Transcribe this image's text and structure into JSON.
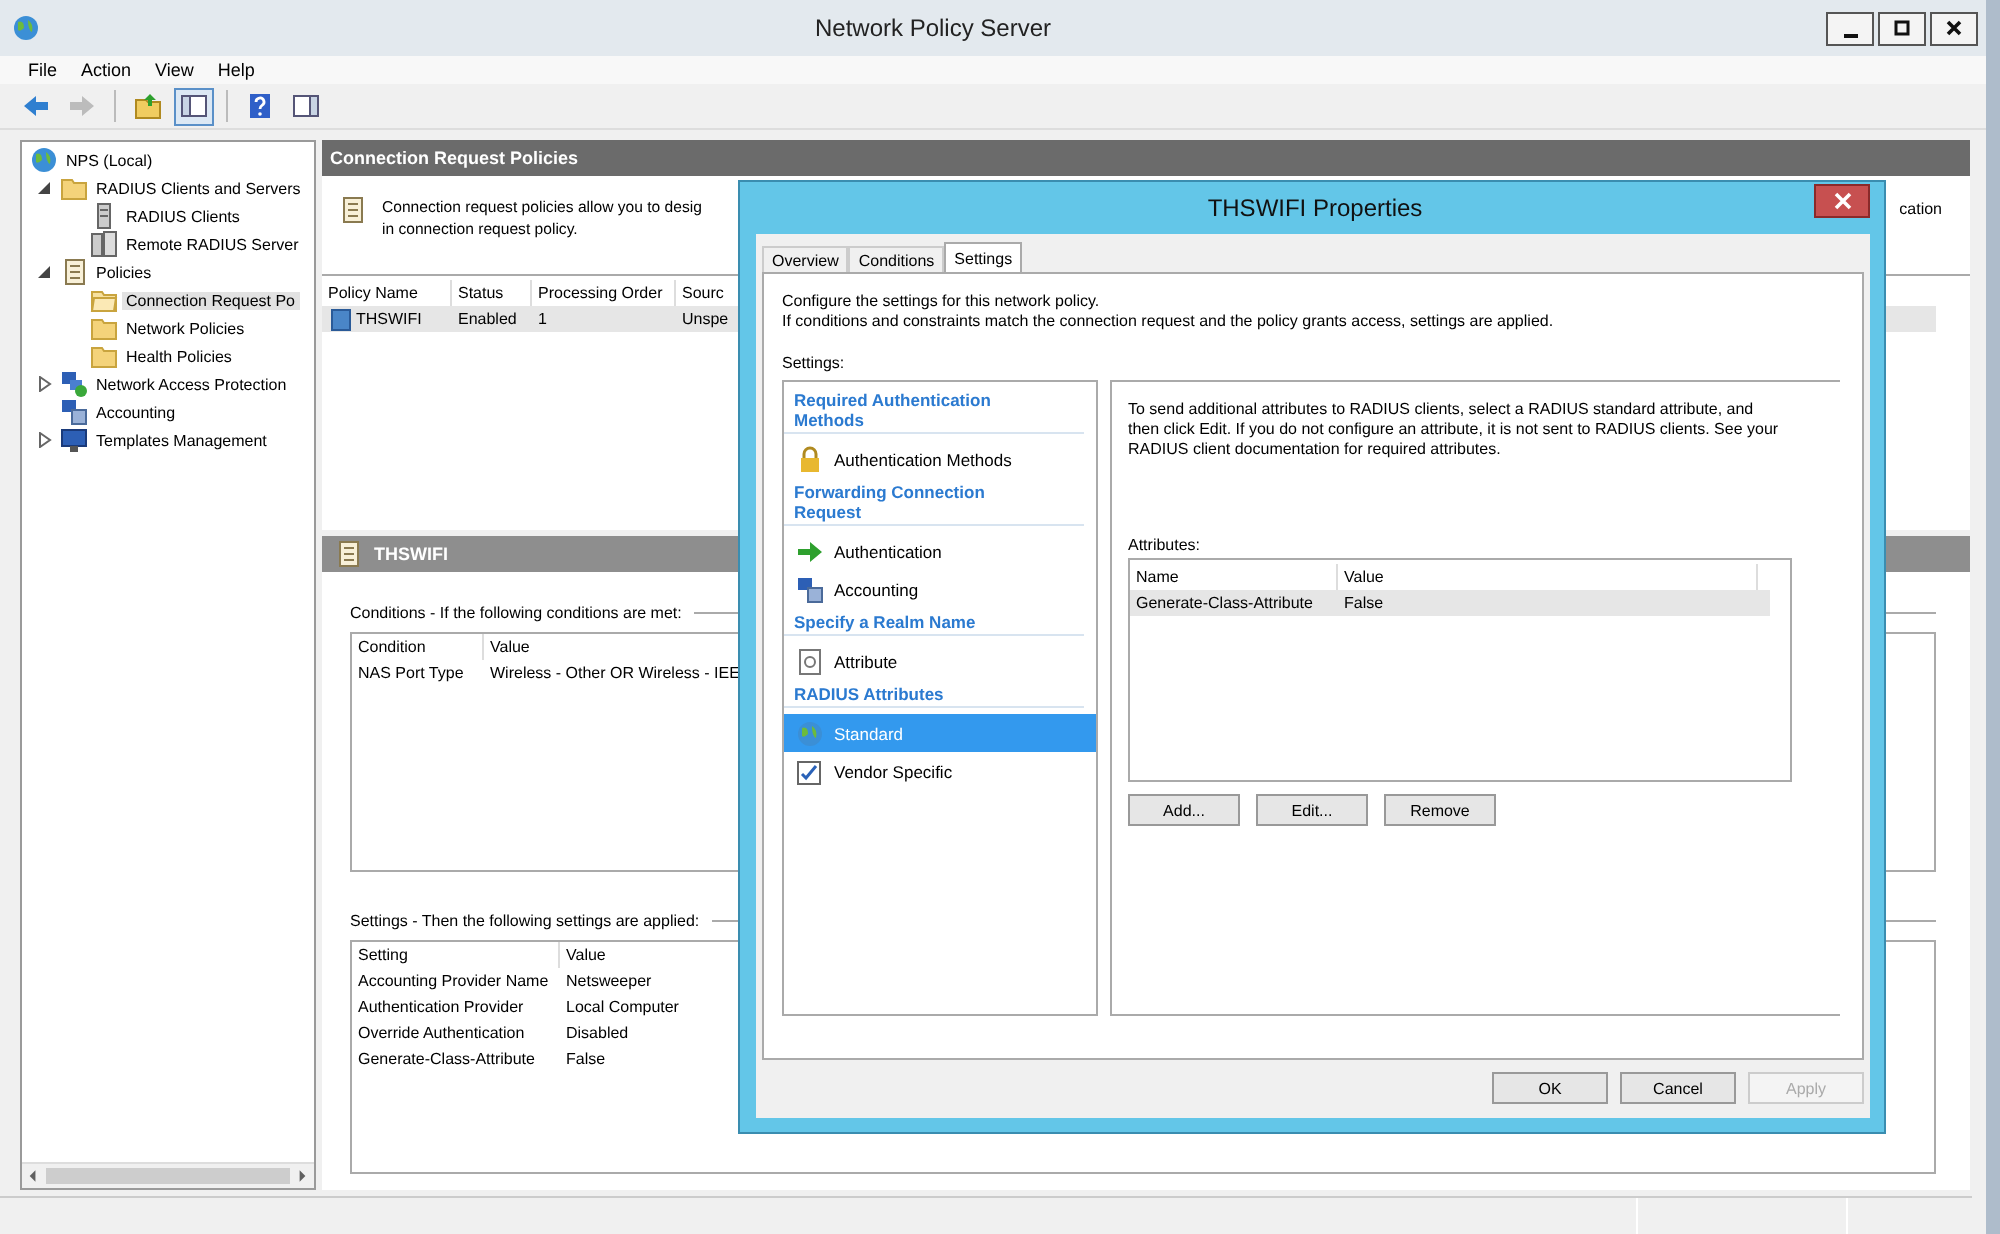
{
  "window": {
    "title": "Network Policy Server"
  },
  "menu": [
    "File",
    "Action",
    "View",
    "Help"
  ],
  "toolbar": [
    {
      "kind": "back",
      "disabled": false,
      "pressed": false
    },
    {
      "kind": "forward",
      "disabled": true,
      "pressed": false
    },
    {
      "kind": "up",
      "disabled": false,
      "pressed": false
    },
    {
      "kind": "tree-toggle",
      "disabled": false,
      "pressed": true
    },
    {
      "kind": "help",
      "disabled": false,
      "pressed": false
    },
    {
      "kind": "action-pane",
      "disabled": false,
      "pressed": false
    }
  ],
  "tree": [
    {
      "label": "NPS (Local)",
      "kind": "globe",
      "selected": false,
      "children": [
        {
          "label": "RADIUS Clients and Servers",
          "kind": "folder",
          "expanded": true,
          "selected": false,
          "children": [
            {
              "label": "RADIUS Clients",
              "kind": "server",
              "selected": false
            },
            {
              "label": "Remote RADIUS Server",
              "kind": "servers",
              "selected": false
            }
          ]
        },
        {
          "label": "Policies",
          "kind": "document",
          "expanded": true,
          "selected": false,
          "children": [
            {
              "label": "Connection Request Po",
              "kind": "folder-open",
              "selected": true
            },
            {
              "label": "Network Policies",
              "kind": "folder",
              "selected": false
            },
            {
              "label": "Health Policies",
              "kind": "folder",
              "selected": false
            }
          ]
        },
        {
          "label": "Network Access Protection",
          "kind": "network",
          "expanded": false,
          "selected": false
        },
        {
          "label": "Accounting",
          "kind": "computers",
          "selected": false
        },
        {
          "label": "Templates Management",
          "kind": "monitor",
          "expanded": false,
          "selected": false
        }
      ]
    }
  ],
  "content": {
    "header": "Connection Request Policies",
    "description": [
      "Connection request policies allow you to desig",
      "in connection request policy."
    ],
    "description_tail": "cation",
    "policies": {
      "columns": [
        "Policy Name",
        "Status",
        "Processing Order",
        "Sourc"
      ],
      "rows": [
        {
          "cells": [
            "THSWIFI",
            "Enabled",
            "1",
            "Unspe"
          ],
          "selected": true
        }
      ]
    },
    "detail": {
      "title": "THSWIFI",
      "conditions_label": "Conditions - If the following conditions are met:",
      "conditions": {
        "columns": [
          "Condition",
          "Value"
        ],
        "rows": [
          [
            "NAS Port Type",
            "Wireless - Other OR Wireless - IEE"
          ]
        ]
      },
      "settings_label": "Settings - Then the following settings are applied:",
      "settings": {
        "columns": [
          "Setting",
          "Value"
        ],
        "rows": [
          [
            "Accounting Provider Name",
            "Netsweeper"
          ],
          [
            "Authentication Provider",
            "Local Computer"
          ],
          [
            "Override Authentication",
            "Disabled"
          ],
          [
            "Generate-Class-Attribute",
            "False"
          ]
        ]
      }
    }
  },
  "dialog": {
    "title": "THSWIFI Properties",
    "tabs": [
      {
        "label": "Overview",
        "selected": false
      },
      {
        "label": "Conditions",
        "selected": false
      },
      {
        "label": "Settings",
        "selected": true
      }
    ],
    "intro": [
      "Configure the settings for this network policy.",
      "If conditions and constraints match the connection request and the policy grants access, settings are applied."
    ],
    "settings_label": "Settings:",
    "sections": [
      {
        "heading": "Required Authentication Methods",
        "items": [
          {
            "label": "Authentication Methods",
            "kind": "lock",
            "selected": false
          }
        ]
      },
      {
        "heading": "Forwarding Connection Request",
        "items": [
          {
            "label": "Authentication",
            "kind": "arrow",
            "selected": false
          },
          {
            "label": "Accounting",
            "kind": "computers",
            "selected": false
          }
        ]
      },
      {
        "heading": "Specify a Realm Name",
        "items": [
          {
            "label": "Attribute",
            "kind": "attribute",
            "selected": false
          }
        ]
      },
      {
        "heading": "RADIUS Attributes",
        "items": [
          {
            "label": "Standard",
            "kind": "globe",
            "selected": true
          },
          {
            "label": "Vendor Specific",
            "kind": "checkbox",
            "selected": false
          }
        ]
      }
    ],
    "info": "To send additional attributes to RADIUS clients, select a RADIUS standard attribute, and then click Edit. If you do not configure an attribute, it is not sent to RADIUS clients. See your RADIUS client documentation for required attributes.",
    "attributes_label": "Attributes:",
    "attributes": {
      "columns": [
        "Name",
        "Value"
      ],
      "rows": [
        {
          "cells": [
            "Generate-Class-Attribute",
            "False"
          ],
          "selected": true
        }
      ]
    },
    "attribute_buttons": [
      "Add...",
      "Edit...",
      "Remove"
    ],
    "buttons": [
      {
        "label": "OK",
        "disabled": false
      },
      {
        "label": "Cancel",
        "disabled": false
      },
      {
        "label": "Apply",
        "disabled": true
      }
    ]
  }
}
